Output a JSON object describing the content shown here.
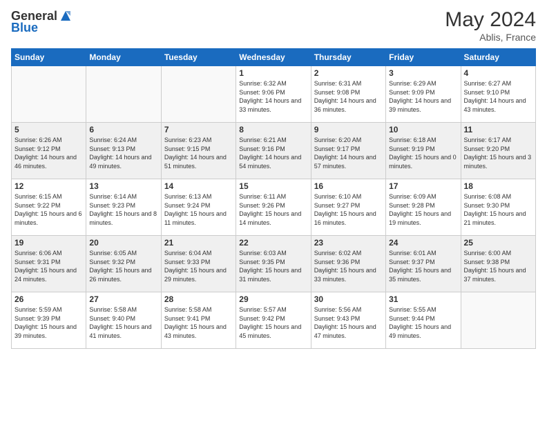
{
  "header": {
    "logo_general": "General",
    "logo_blue": "Blue",
    "month_year": "May 2024",
    "location": "Ablis, France"
  },
  "days_of_week": [
    "Sunday",
    "Monday",
    "Tuesday",
    "Wednesday",
    "Thursday",
    "Friday",
    "Saturday"
  ],
  "weeks": [
    {
      "shaded": false,
      "days": [
        {
          "num": "",
          "sunrise": "",
          "sunset": "",
          "daylight": ""
        },
        {
          "num": "",
          "sunrise": "",
          "sunset": "",
          "daylight": ""
        },
        {
          "num": "",
          "sunrise": "",
          "sunset": "",
          "daylight": ""
        },
        {
          "num": "1",
          "sunrise": "Sunrise: 6:32 AM",
          "sunset": "Sunset: 9:06 PM",
          "daylight": "Daylight: 14 hours and 33 minutes."
        },
        {
          "num": "2",
          "sunrise": "Sunrise: 6:31 AM",
          "sunset": "Sunset: 9:08 PM",
          "daylight": "Daylight: 14 hours and 36 minutes."
        },
        {
          "num": "3",
          "sunrise": "Sunrise: 6:29 AM",
          "sunset": "Sunset: 9:09 PM",
          "daylight": "Daylight: 14 hours and 39 minutes."
        },
        {
          "num": "4",
          "sunrise": "Sunrise: 6:27 AM",
          "sunset": "Sunset: 9:10 PM",
          "daylight": "Daylight: 14 hours and 43 minutes."
        }
      ]
    },
    {
      "shaded": true,
      "days": [
        {
          "num": "5",
          "sunrise": "Sunrise: 6:26 AM",
          "sunset": "Sunset: 9:12 PM",
          "daylight": "Daylight: 14 hours and 46 minutes."
        },
        {
          "num": "6",
          "sunrise": "Sunrise: 6:24 AM",
          "sunset": "Sunset: 9:13 PM",
          "daylight": "Daylight: 14 hours and 49 minutes."
        },
        {
          "num": "7",
          "sunrise": "Sunrise: 6:23 AM",
          "sunset": "Sunset: 9:15 PM",
          "daylight": "Daylight: 14 hours and 51 minutes."
        },
        {
          "num": "8",
          "sunrise": "Sunrise: 6:21 AM",
          "sunset": "Sunset: 9:16 PM",
          "daylight": "Daylight: 14 hours and 54 minutes."
        },
        {
          "num": "9",
          "sunrise": "Sunrise: 6:20 AM",
          "sunset": "Sunset: 9:17 PM",
          "daylight": "Daylight: 14 hours and 57 minutes."
        },
        {
          "num": "10",
          "sunrise": "Sunrise: 6:18 AM",
          "sunset": "Sunset: 9:19 PM",
          "daylight": "Daylight: 15 hours and 0 minutes."
        },
        {
          "num": "11",
          "sunrise": "Sunrise: 6:17 AM",
          "sunset": "Sunset: 9:20 PM",
          "daylight": "Daylight: 15 hours and 3 minutes."
        }
      ]
    },
    {
      "shaded": false,
      "days": [
        {
          "num": "12",
          "sunrise": "Sunrise: 6:15 AM",
          "sunset": "Sunset: 9:22 PM",
          "daylight": "Daylight: 15 hours and 6 minutes."
        },
        {
          "num": "13",
          "sunrise": "Sunrise: 6:14 AM",
          "sunset": "Sunset: 9:23 PM",
          "daylight": "Daylight: 15 hours and 8 minutes."
        },
        {
          "num": "14",
          "sunrise": "Sunrise: 6:13 AM",
          "sunset": "Sunset: 9:24 PM",
          "daylight": "Daylight: 15 hours and 11 minutes."
        },
        {
          "num": "15",
          "sunrise": "Sunrise: 6:11 AM",
          "sunset": "Sunset: 9:26 PM",
          "daylight": "Daylight: 15 hours and 14 minutes."
        },
        {
          "num": "16",
          "sunrise": "Sunrise: 6:10 AM",
          "sunset": "Sunset: 9:27 PM",
          "daylight": "Daylight: 15 hours and 16 minutes."
        },
        {
          "num": "17",
          "sunrise": "Sunrise: 6:09 AM",
          "sunset": "Sunset: 9:28 PM",
          "daylight": "Daylight: 15 hours and 19 minutes."
        },
        {
          "num": "18",
          "sunrise": "Sunrise: 6:08 AM",
          "sunset": "Sunset: 9:30 PM",
          "daylight": "Daylight: 15 hours and 21 minutes."
        }
      ]
    },
    {
      "shaded": true,
      "days": [
        {
          "num": "19",
          "sunrise": "Sunrise: 6:06 AM",
          "sunset": "Sunset: 9:31 PM",
          "daylight": "Daylight: 15 hours and 24 minutes."
        },
        {
          "num": "20",
          "sunrise": "Sunrise: 6:05 AM",
          "sunset": "Sunset: 9:32 PM",
          "daylight": "Daylight: 15 hours and 26 minutes."
        },
        {
          "num": "21",
          "sunrise": "Sunrise: 6:04 AM",
          "sunset": "Sunset: 9:33 PM",
          "daylight": "Daylight: 15 hours and 29 minutes."
        },
        {
          "num": "22",
          "sunrise": "Sunrise: 6:03 AM",
          "sunset": "Sunset: 9:35 PM",
          "daylight": "Daylight: 15 hours and 31 minutes."
        },
        {
          "num": "23",
          "sunrise": "Sunrise: 6:02 AM",
          "sunset": "Sunset: 9:36 PM",
          "daylight": "Daylight: 15 hours and 33 minutes."
        },
        {
          "num": "24",
          "sunrise": "Sunrise: 6:01 AM",
          "sunset": "Sunset: 9:37 PM",
          "daylight": "Daylight: 15 hours and 35 minutes."
        },
        {
          "num": "25",
          "sunrise": "Sunrise: 6:00 AM",
          "sunset": "Sunset: 9:38 PM",
          "daylight": "Daylight: 15 hours and 37 minutes."
        }
      ]
    },
    {
      "shaded": false,
      "days": [
        {
          "num": "26",
          "sunrise": "Sunrise: 5:59 AM",
          "sunset": "Sunset: 9:39 PM",
          "daylight": "Daylight: 15 hours and 39 minutes."
        },
        {
          "num": "27",
          "sunrise": "Sunrise: 5:58 AM",
          "sunset": "Sunset: 9:40 PM",
          "daylight": "Daylight: 15 hours and 41 minutes."
        },
        {
          "num": "28",
          "sunrise": "Sunrise: 5:58 AM",
          "sunset": "Sunset: 9:41 PM",
          "daylight": "Daylight: 15 hours and 43 minutes."
        },
        {
          "num": "29",
          "sunrise": "Sunrise: 5:57 AM",
          "sunset": "Sunset: 9:42 PM",
          "daylight": "Daylight: 15 hours and 45 minutes."
        },
        {
          "num": "30",
          "sunrise": "Sunrise: 5:56 AM",
          "sunset": "Sunset: 9:43 PM",
          "daylight": "Daylight: 15 hours and 47 minutes."
        },
        {
          "num": "31",
          "sunrise": "Sunrise: 5:55 AM",
          "sunset": "Sunset: 9:44 PM",
          "daylight": "Daylight: 15 hours and 49 minutes."
        },
        {
          "num": "",
          "sunrise": "",
          "sunset": "",
          "daylight": ""
        }
      ]
    }
  ]
}
